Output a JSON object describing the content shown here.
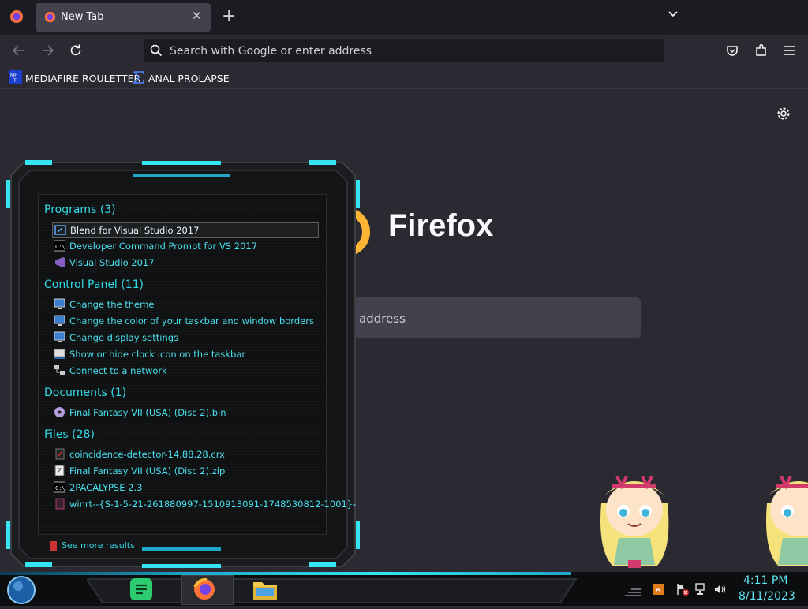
{
  "browser": {
    "tab": {
      "title": "New Tab"
    },
    "urlbar": {
      "placeholder": "Search with Google or enter address"
    },
    "bookmarks": [
      {
        "label": "MEDIAFIRE ROULETTER",
        "icon": "mediafire-icon"
      },
      {
        "label": "ANAL PROLAPSE",
        "icon": "sigma-icon"
      }
    ],
    "newtab": {
      "wordmark": "Firefox",
      "search_placeholder_visible": "address"
    }
  },
  "start_menu": {
    "sections": [
      {
        "heading": "Programs (3)",
        "items": [
          {
            "label": "Blend for Visual Studio 2017",
            "icon": "blend-icon",
            "selected": true
          },
          {
            "label": "Developer Command Prompt for VS 2017",
            "icon": "command-prompt-icon"
          },
          {
            "label": "Visual Studio 2017",
            "icon": "visual-studio-icon"
          }
        ]
      },
      {
        "heading": "Control Panel (11)",
        "items": [
          {
            "label": "Change the theme",
            "icon": "display-settings-icon"
          },
          {
            "label": "Change the color of your taskbar and window borders",
            "icon": "display-settings-icon"
          },
          {
            "label": "Change display settings",
            "icon": "display-settings-icon"
          },
          {
            "label": "Show or hide clock icon on the taskbar",
            "icon": "taskbar-icon"
          },
          {
            "label": "Connect to a network",
            "icon": "network-icon"
          }
        ]
      },
      {
        "heading": "Documents (1)",
        "items": [
          {
            "label": "Final Fantasy VII (USA) (Disc 2).bin",
            "icon": "disc-image-icon"
          }
        ]
      },
      {
        "heading": "Files (28)",
        "items": [
          {
            "label": "coincidence-detector-14.88.28.crx",
            "icon": "extension-file-icon"
          },
          {
            "label": "Final Fantasy VII (USA) (Disc 2).zip",
            "icon": "zip-file-icon"
          },
          {
            "label": "2PACALYPSE 2.3",
            "icon": "command-prompt-icon"
          },
          {
            "label": "winrt--{S-1-5-21-261880997-1510913091-1748530812-1001}-",
            "icon": "file-icon"
          }
        ]
      }
    ],
    "see_more": "See more results"
  },
  "taskbar": {
    "time": "4:11 PM",
    "date": "8/11/2023",
    "pinned": [
      "notes-app-icon",
      "firefox-icon",
      "file-explorer-icon"
    ]
  },
  "colors": {
    "accent_cyan": "#33d9e8",
    "chrome_dark": "#1c1b22",
    "page_bg": "#2b2a33"
  }
}
